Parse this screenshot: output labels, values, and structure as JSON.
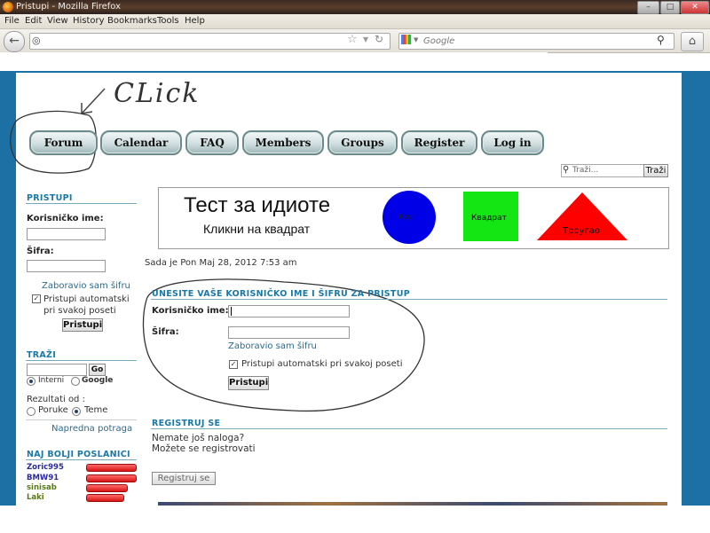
{
  "window": {
    "title": "Pristupi - Mozilla Firefox",
    "controls": [
      "minimize-icon",
      "maximize-icon",
      "close-icon"
    ]
  },
  "menubar": [
    "File",
    "Edit",
    "View",
    "History",
    "Bookmarks",
    "Tools",
    "Help"
  ],
  "navbar": {
    "search_placeholder": "Google",
    "icons": [
      "back-icon",
      "site-icon",
      "star-icon",
      "reload-icon",
      "google-icon",
      "search-icon",
      "home-icon"
    ]
  },
  "annotation": {
    "click_text": "CLick"
  },
  "site_nav": [
    "Forum",
    "Calendar",
    "FAQ",
    "Members",
    "Groups",
    "Register",
    "Log in"
  ],
  "site_search": {
    "placeholder": "Traži...",
    "button": "Traži"
  },
  "sidebar": {
    "login_title": "PRISTUPI",
    "username_label": "Korisničko ime:",
    "password_label": "Šifra:",
    "forgot_link": "Zaboravio sam šifru",
    "remember_label": "Pristupi automatski pri svakoj poseti",
    "remember_checked": true,
    "login_button": "Pristupi",
    "search_title": "TRAŽI",
    "search_go": "Go",
    "search_opt_internal": "Interni",
    "search_opt_google": "Google",
    "results_label": "Rezultati od :",
    "results_opt_posts": "Poruke",
    "results_opt_topics": "Teme",
    "advanced_link": "Napredna potraga",
    "top_posters_title": "NAJ BOLJI POSLANICI",
    "top_posters": [
      {
        "name": "Zoric995",
        "color": "#2a2a9e",
        "level": 1.0
      },
      {
        "name": "BMW91",
        "color": "#2a2a9e",
        "level": 1.0
      },
      {
        "name": "sinisab",
        "color": "#5a7a1a",
        "level": 0.82
      },
      {
        "name": "Laki",
        "color": "#5a7a1a",
        "level": 0.75
      }
    ]
  },
  "ad": {
    "title": "Тест за идиоте",
    "subtitle": "Кликни на квадрат",
    "circle_label": "Круг",
    "square_label": "Квадрат",
    "triangle_label": "Троугао"
  },
  "main": {
    "datetime": "Sada je Pon Maj 28, 2012 7:53 am",
    "login_title": "UNESITE VAŠE KORISNIČKO IME I ŠIFRU ZA PRISTUP",
    "username_label": "Korisničko ime:",
    "password_label": "Šifra:",
    "forgot_link": "Zaboravio sam šifru",
    "remember_label": "Pristupi automatski pri svakoj poseti",
    "remember_checked": true,
    "login_button": "Pristupi",
    "register_title": "REGISTRUJ SE",
    "register_line1": "Nemate još naloga?",
    "register_line2": "Možete se registrovati",
    "register_button": "Registruj se"
  }
}
